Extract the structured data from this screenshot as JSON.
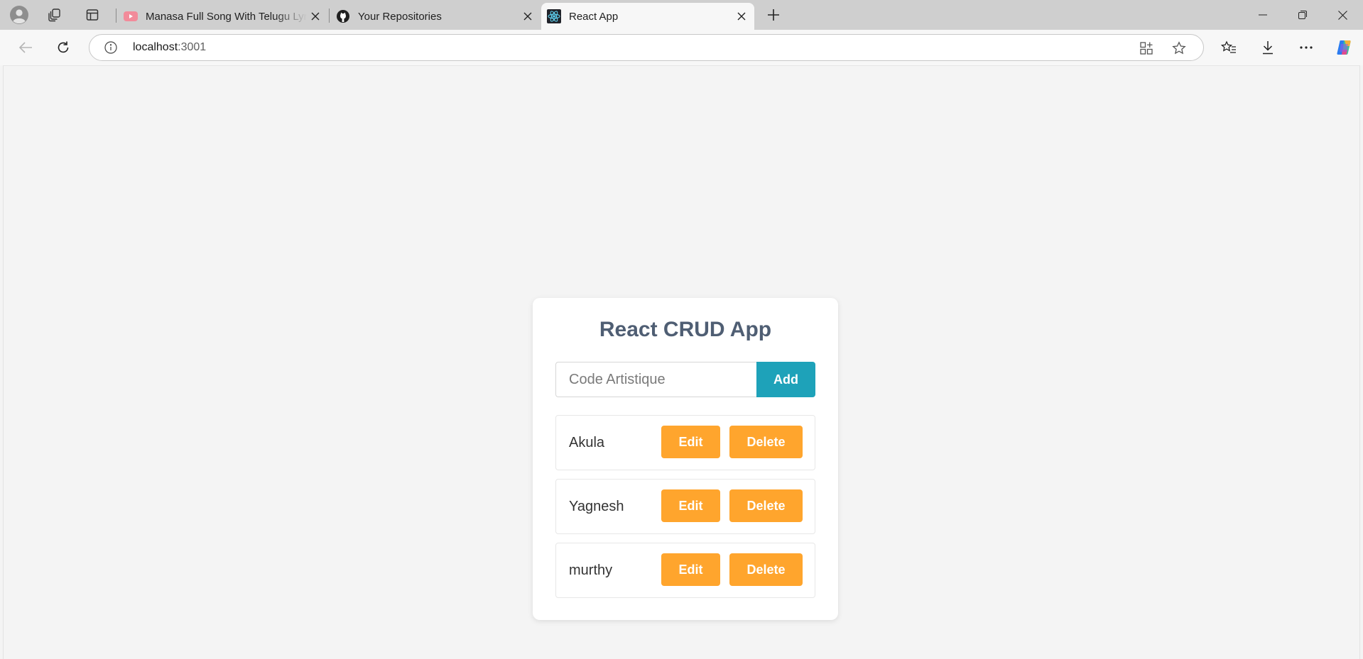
{
  "browser": {
    "tabs": [
      {
        "title": "Manasa Full Song With Telugu Lyrics",
        "favicon": "youtube-icon",
        "active": false
      },
      {
        "title": "Your Repositories",
        "favicon": "github-icon",
        "active": false
      },
      {
        "title": "React App",
        "favicon": "react-icon",
        "active": true
      }
    ],
    "address": {
      "host": "localhost",
      "port": ":3001"
    },
    "colors": {
      "tab_strip": "#cfcfcf",
      "toolbar": "#f7f7f7"
    }
  },
  "app": {
    "title": "React CRUD App",
    "input": {
      "placeholder": "Code Artistique",
      "value": ""
    },
    "add_label": "Add",
    "items": [
      {
        "name": "Akula",
        "edit_label": "Edit",
        "delete_label": "Delete"
      },
      {
        "name": "Yagnesh",
        "edit_label": "Edit",
        "delete_label": "Delete"
      },
      {
        "name": "murthy",
        "edit_label": "Edit",
        "delete_label": "Delete"
      }
    ],
    "colors": {
      "title": "#4f5e73",
      "add_button": "#1ea2b9",
      "action_button": "#ffa52d",
      "background": "#f4f4f4"
    }
  }
}
